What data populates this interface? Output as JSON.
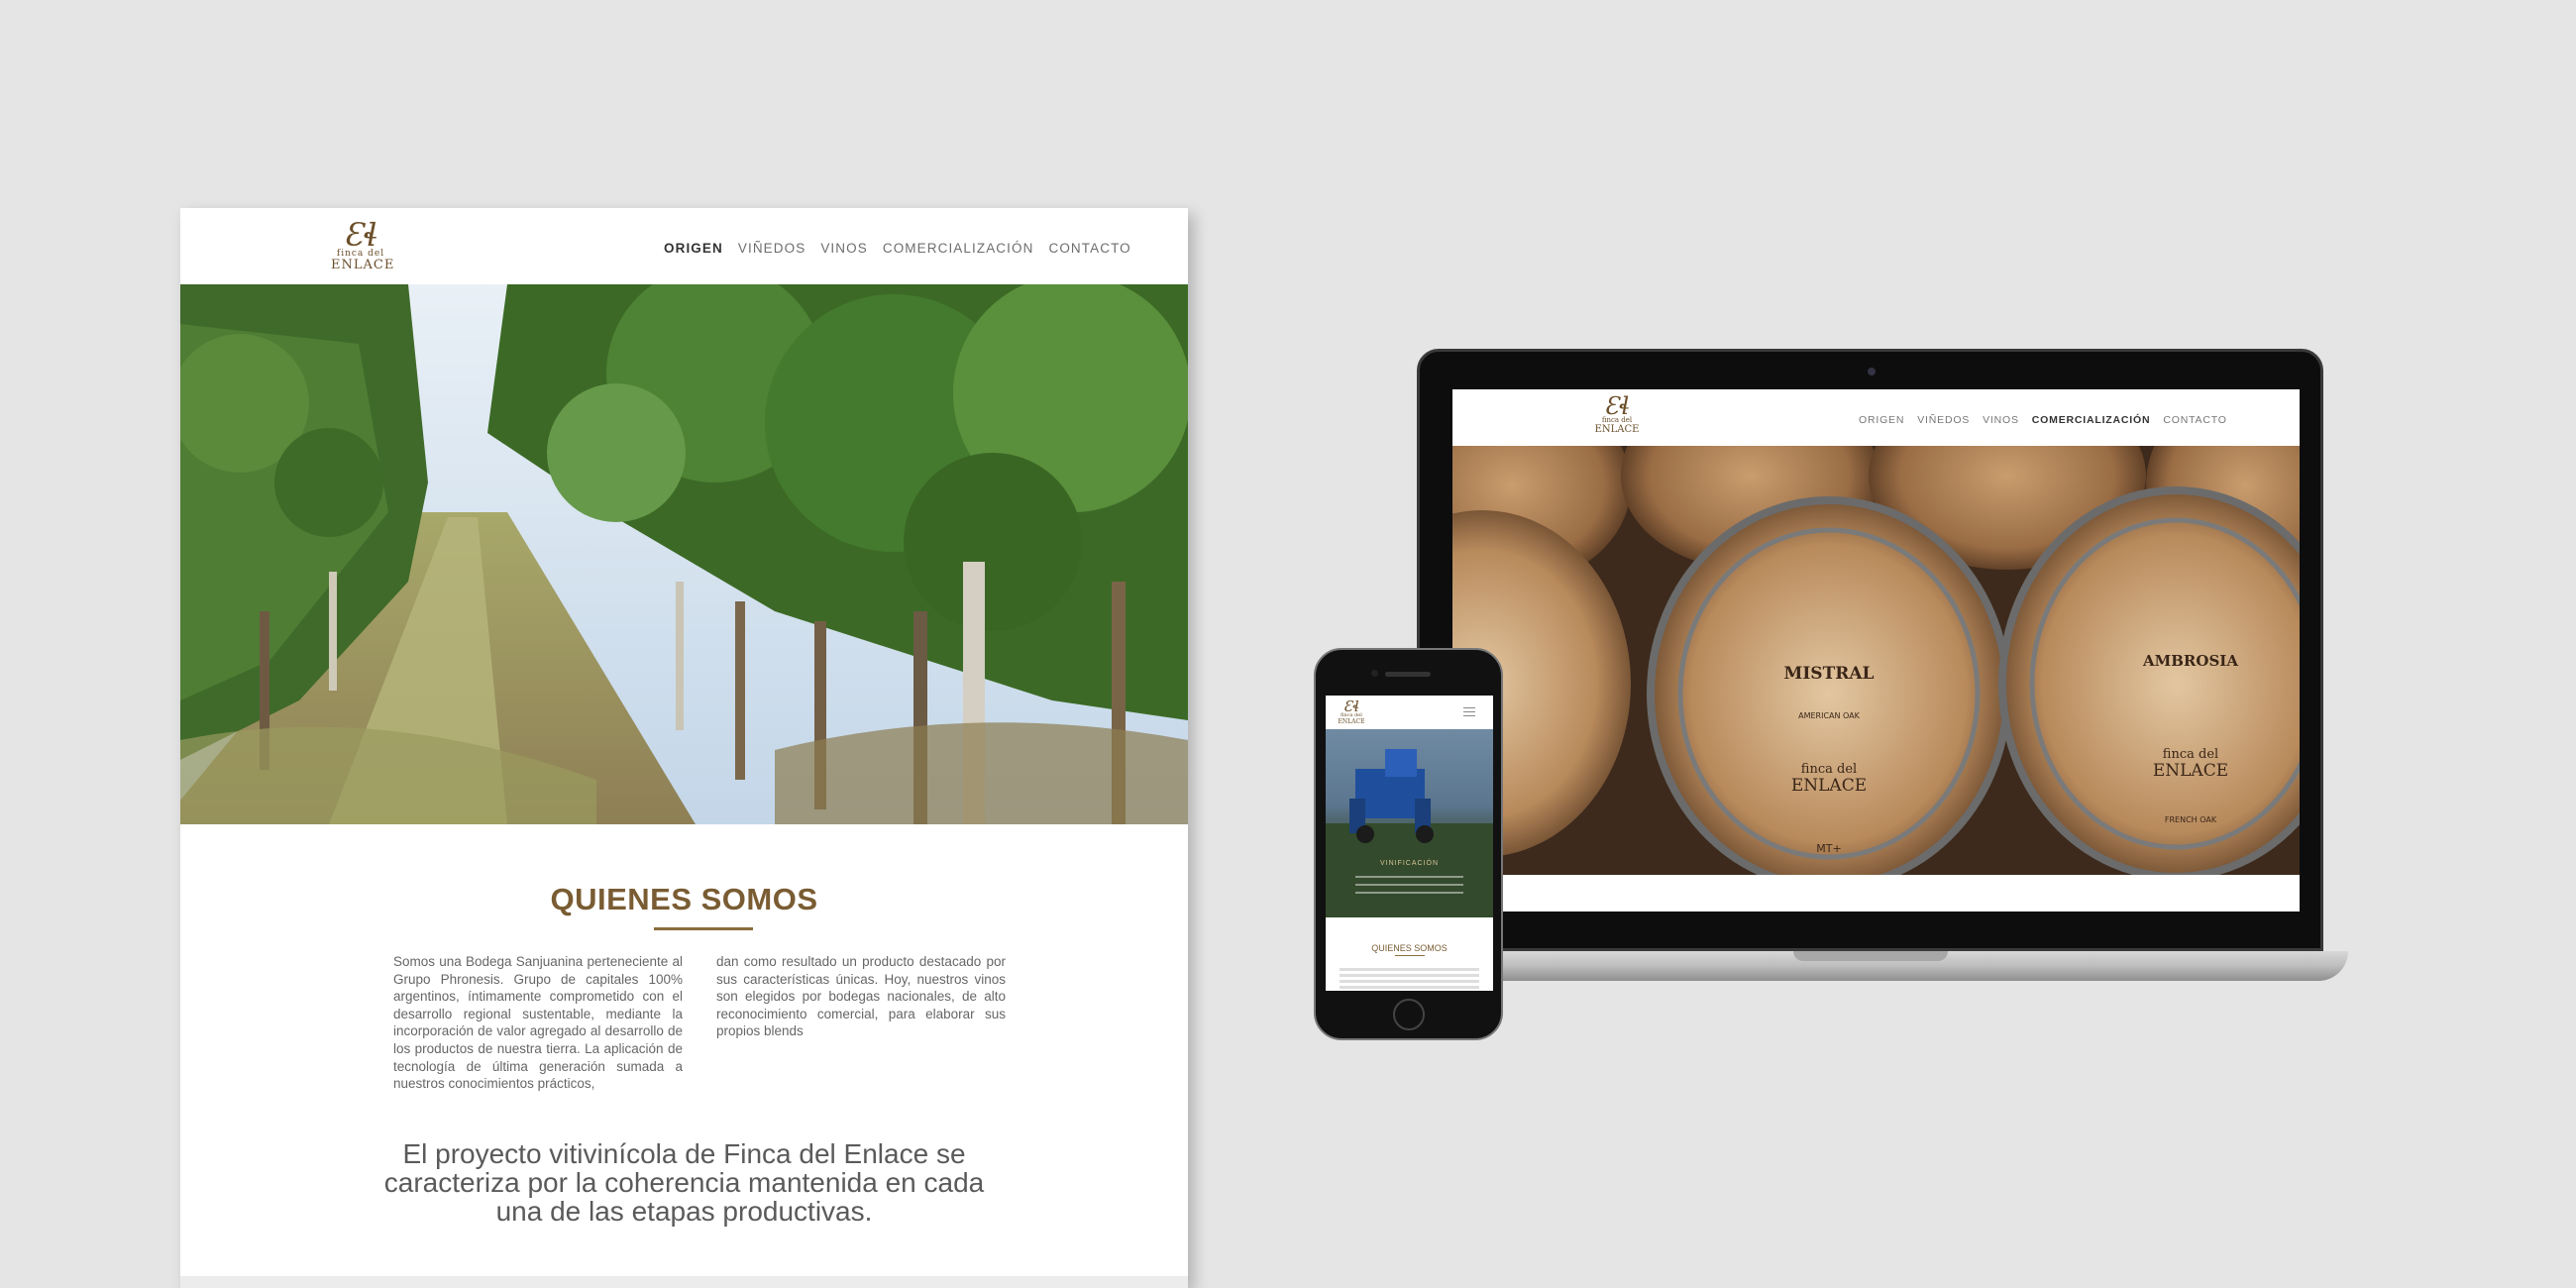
{
  "desktop": {
    "logo": {
      "mark": "Ɛɬ",
      "line1": "finca del",
      "line2": "ENLACE"
    },
    "nav": [
      "ORIGEN",
      "VIÑEDOS",
      "VINOS",
      "COMERCIALIZACIÓN",
      "CONTACTO"
    ],
    "active_nav": "ORIGEN",
    "section_title": "QUIENES SOMOS",
    "paragraph_left": "Somos una Bodega Sanjuanina perteneciente al Grupo Phronesis. Grupo de capitales 100% argentinos, íntimamente comprometido con el desarrollo regional sustentable, mediante la incorporación de valor agregado al desarrollo de los productos de nuestra tierra. La aplicación de tecnología de última generación sumada a nuestros conocimientos prácticos,",
    "paragraph_right": "dan como resultado un producto destacado por sus características únicas. Hoy, nuestros vinos son elegidos por bodegas nacionales, de alto reconocimiento comercial, para elaborar sus propios blends",
    "quote": "El proyecto vitivinícola de Finca del Enlace se caracteriza por la coherencia mantenida en cada una de las etapas productivas."
  },
  "laptop": {
    "logo": {
      "mark": "Ɛɬ",
      "line1": "finca del",
      "line2": "ENLACE"
    },
    "nav": [
      "ORIGEN",
      "VIÑEDOS",
      "VINOS",
      "COMERCIALIZACIÓN",
      "CONTACTO"
    ],
    "active_nav": "COMERCIALIZACIÓN",
    "barrel_labels": [
      "MISTRAL",
      "AMERICAN OAK",
      "finca del",
      "ENLACE",
      "AMBROSIA",
      "finca del",
      "ENLACE",
      "FRENCH OAK",
      "MT+"
    ]
  },
  "phone": {
    "logo": {
      "mark": "Ɛɬ",
      "line1": "finca del",
      "line2": "ENLACE"
    },
    "hero_kicker": "VINIFICACIÓN",
    "section_title": "QUIENES SOMOS"
  },
  "colors": {
    "accent": "#7a5c33",
    "background": "#e5e5e5"
  }
}
